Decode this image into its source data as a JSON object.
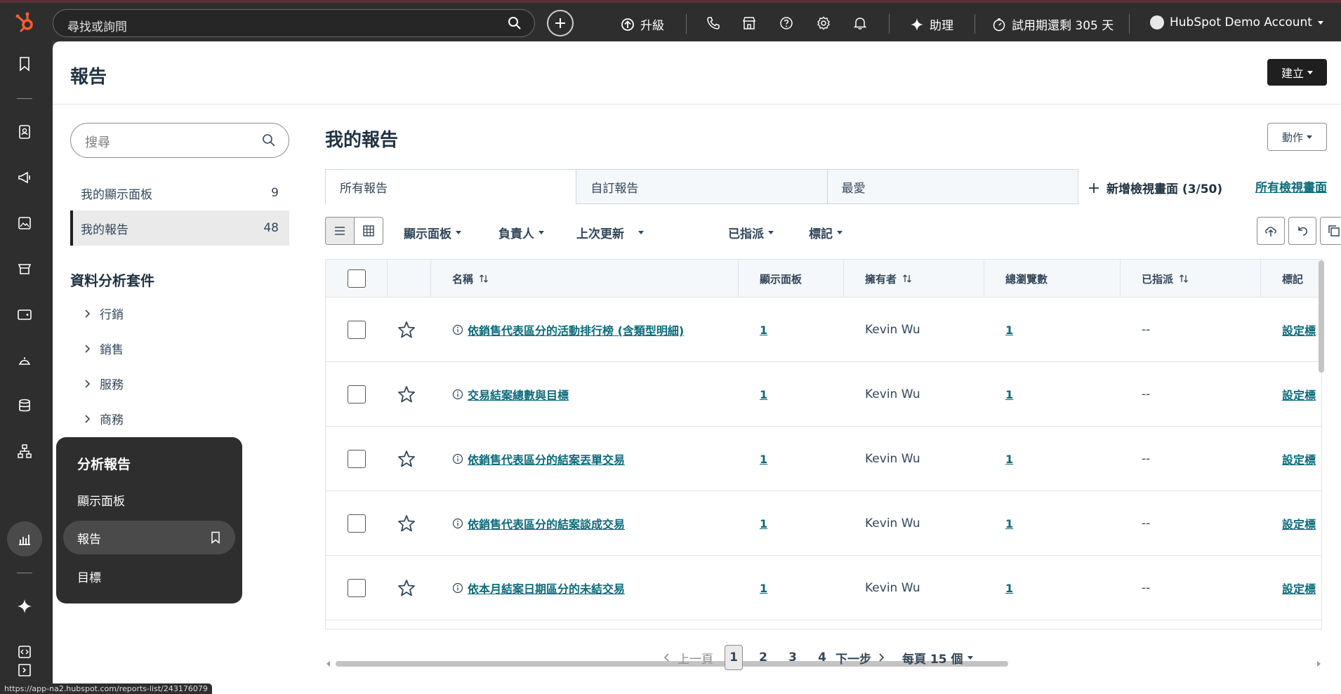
{
  "topbar": {
    "search_placeholder": "尋找或詢問",
    "upgrade_label": "升級",
    "assistant_label": "助理",
    "trial_label": "試用期還剩 305 天",
    "account_label": "HubSpot Demo Account",
    "brand_color": "#ff5c35"
  },
  "page": {
    "title": "報告",
    "create_label": "建立"
  },
  "sidebar": {
    "search_placeholder": "搜尋",
    "items": [
      {
        "label": "我的顯示面板",
        "count": "9"
      },
      {
        "label": "我的報告",
        "count": "48"
      }
    ],
    "suite_title": "資料分析套件",
    "suite_items": [
      "行銷",
      "銷售",
      "服務",
      "商務"
    ]
  },
  "flyout": {
    "title": "分析報告",
    "items": [
      "顯示面板",
      "報告",
      "目標"
    ]
  },
  "content": {
    "title": "我的報告",
    "actions_label": "動作",
    "tabs": [
      "所有報告",
      "自訂報告",
      "最愛"
    ],
    "add_view_label": "新增檢視畫面 (3/50)",
    "all_views_label": "所有檢視畫面",
    "filters": [
      "顯示面板",
      "負責人",
      "上次更新",
      "已指派",
      "標記"
    ]
  },
  "table": {
    "headers": {
      "name": "名稱",
      "dashboard": "顯示面板",
      "owner": "擁有者",
      "views": "總瀏覽數",
      "assigned": "已指派",
      "tags": "標記"
    },
    "rows": [
      {
        "name": "依銷售代表區分的活動排行榜 (含類型明細)",
        "dashboard": "1",
        "owner": "Kevin Wu",
        "views": "1",
        "assigned": "--",
        "tags": "設定標"
      },
      {
        "name": "交易結案總數與目標",
        "dashboard": "1",
        "owner": "Kevin Wu",
        "views": "1",
        "assigned": "--",
        "tags": "設定標"
      },
      {
        "name": "依銷售代表區分的結案丟單交易",
        "dashboard": "1",
        "owner": "Kevin Wu",
        "views": "1",
        "assigned": "--",
        "tags": "設定標"
      },
      {
        "name": "依銷售代表區分的結案談成交易",
        "dashboard": "1",
        "owner": "Kevin Wu",
        "views": "1",
        "assigned": "--",
        "tags": "設定標"
      },
      {
        "name": "依本月結案日期區分的未結交易",
        "dashboard": "1",
        "owner": "Kevin Wu",
        "views": "1",
        "assigned": "--",
        "tags": "設定標"
      }
    ]
  },
  "pagination": {
    "prev_label": "上一頁",
    "pages": [
      "1",
      "2",
      "3",
      "4"
    ],
    "current": "1",
    "next_label": "下一步",
    "per_page_label": "每頁 15 個"
  },
  "statusbar": {
    "url": "https://app-na2.hubspot.com/reports-list/243176079"
  }
}
